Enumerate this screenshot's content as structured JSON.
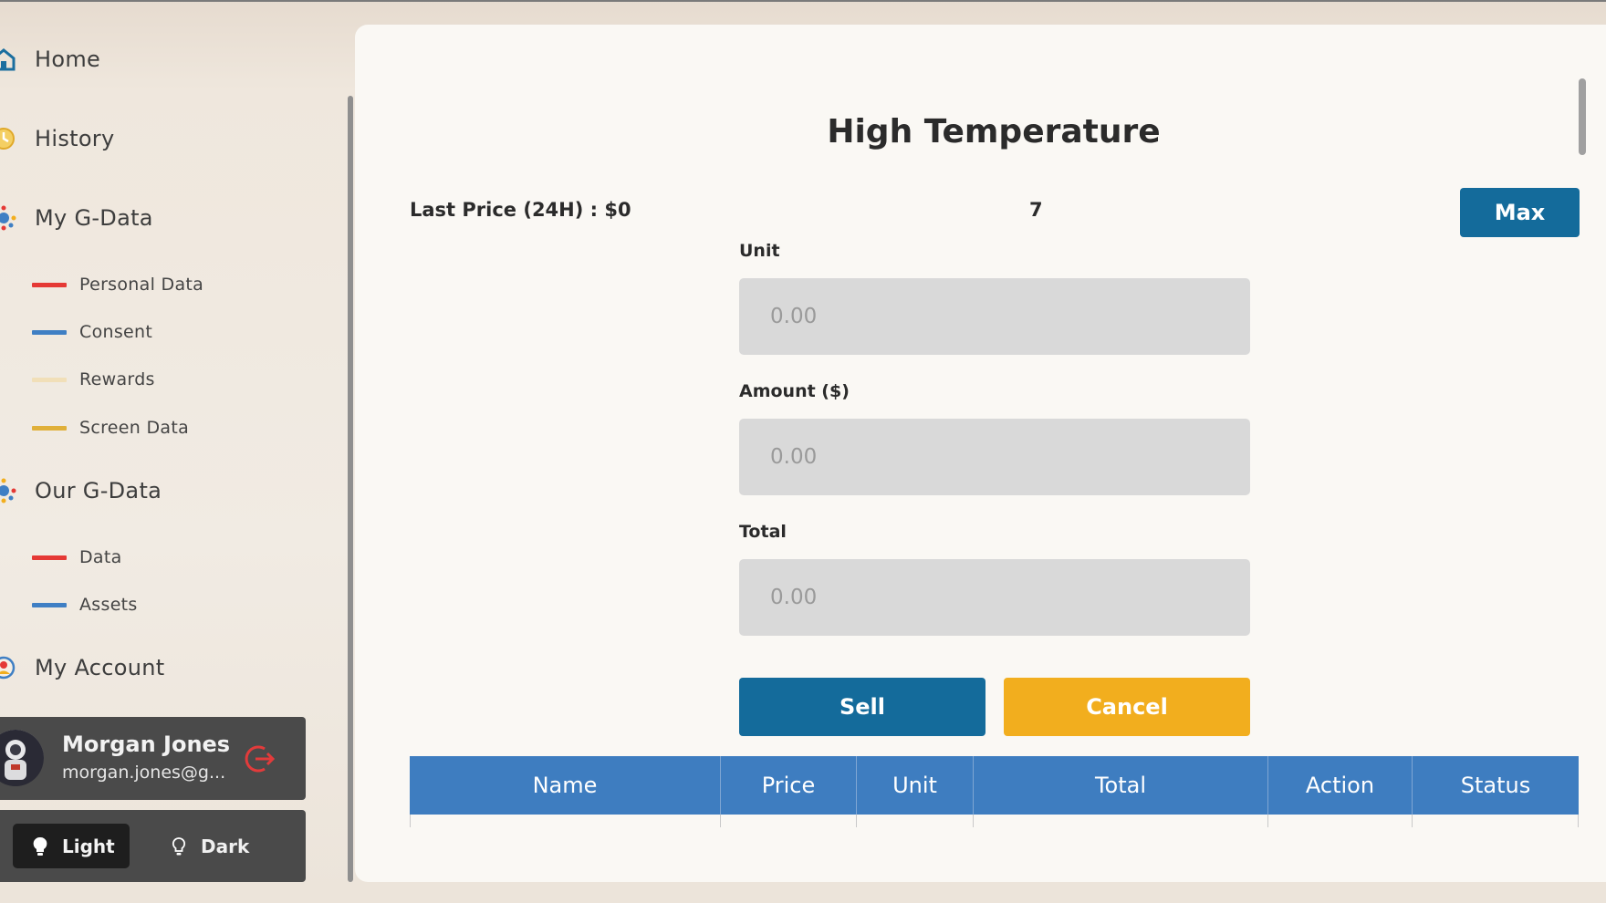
{
  "sidebar": {
    "nav": [
      {
        "label": "Home",
        "icon": "home-icon"
      },
      {
        "label": "History",
        "icon": "history-icon"
      },
      {
        "label": "My G-Data",
        "icon": "g-data-icon"
      },
      {
        "label": "Our G-Data",
        "icon": "our-g-data-icon"
      },
      {
        "label": "My Account",
        "icon": "account-icon"
      }
    ],
    "my_gdata_items": [
      {
        "label": "Personal Data",
        "color": "#e53935"
      },
      {
        "label": "Consent",
        "color": "#3f7fc4"
      },
      {
        "label": "Rewards",
        "color": "#f1dfb8"
      },
      {
        "label": "Screen Data",
        "color": "#e0b03a"
      }
    ],
    "our_gdata_items": [
      {
        "label": "Data",
        "color": "#e53935"
      },
      {
        "label": "Assets",
        "color": "#3f7fc4"
      }
    ],
    "user": {
      "name": "Morgan Jones",
      "email": "morgan.jones@g..."
    },
    "theme": {
      "light_label": "Light",
      "dark_label": "Dark",
      "selected": "Light"
    }
  },
  "main": {
    "title": "High Temperature",
    "last_price": "Last Price (24H) : $0",
    "available_units": "7",
    "max_label": "Max",
    "fields": [
      {
        "label": "Unit",
        "placeholder": "0.00"
      },
      {
        "label": "Amount ($)",
        "placeholder": "0.00"
      },
      {
        "label": "Total",
        "placeholder": "0.00"
      }
    ],
    "sell_label": "Sell",
    "cancel_label": "Cancel",
    "table": {
      "columns": [
        "Name",
        "Price",
        "Unit",
        "Total",
        "Action",
        "Status"
      ]
    }
  },
  "colors": {
    "primary": "#146b9b",
    "accent": "#f2ae1e",
    "table_header": "#3e7dc0"
  }
}
